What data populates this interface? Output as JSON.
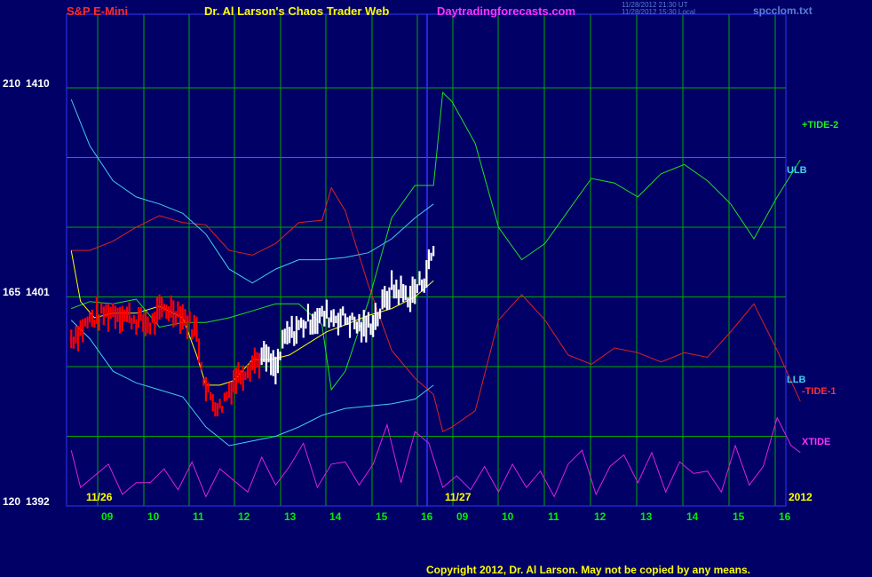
{
  "header": {
    "instrument": "S&P E-Mini",
    "site_title": "Dr. Al Larson's Chaos Trader Web",
    "site_url": "Daytradingforecasts.com",
    "timestamp_ut": "11/28/2012 21:30 UT",
    "timestamp_local": "11/28/2012 15:30 Local",
    "filename": "spcclom.txt"
  },
  "footer": {
    "copyright": "Copyright 2012, Dr. Al Larson. May not be copied by any means."
  },
  "colors": {
    "background": "#000066",
    "grid": "#00aa00",
    "divider": "#3333ff",
    "price_up": "#ffffff",
    "price_down": "#ff0000",
    "tide2": "#22dd22",
    "tide1": "#dd2222",
    "xtide": "#dd22dd",
    "ulb": "#44ccee",
    "llb": "#44ccee",
    "ma": "#ffff00"
  },
  "chart_data": {
    "type": "line",
    "title": "S&P E-Mini",
    "y_left_labels": [
      {
        "osc": "210",
        "price": "1410"
      },
      {
        "osc": "165",
        "price": "1401"
      },
      {
        "osc": "120",
        "price": "1392"
      }
    ],
    "ylim": [
      1392,
      1410
    ],
    "date_labels": [
      "11/26",
      "11/27",
      "2012"
    ],
    "x_ticks_day1": [
      "09",
      "10",
      "11",
      "12",
      "13",
      "14",
      "15",
      "16"
    ],
    "x_ticks_day2": [
      "09",
      "10",
      "11",
      "12",
      "13",
      "14",
      "15",
      "16"
    ],
    "grid": true,
    "series_labels": {
      "tide2": "+TIDE-2",
      "ulb": "ULB",
      "llb": "LLB",
      "tide1": "-TIDE-1",
      "xtide": "XTIDE"
    },
    "series": [
      {
        "name": "+TIDE-2",
        "x": [
          8.1,
          8.5,
          9,
          9.5,
          10,
          10.5,
          11,
          11.5,
          12,
          12.5,
          13,
          13.5,
          13.7,
          14,
          14.5,
          15,
          15.5,
          15.9,
          16.1,
          16.3,
          16.8,
          17.3,
          17.8,
          18.3,
          18.8,
          19.3,
          19.8,
          20.3,
          20.8,
          21.3,
          21.8,
          22.3,
          22.8,
          23.3,
          23.8
        ],
        "y": [
          1400.5,
          1400.8,
          1400.7,
          1400.9,
          1399.7,
          1399.9,
          1399.9,
          1400.1,
          1400.4,
          1400.7,
          1400.7,
          1399.8,
          1397,
          1397.8,
          1400.8,
          1404.4,
          1405.8,
          1405.8,
          1409.8,
          1409.4,
          1407.6,
          1404,
          1402.6,
          1403.3,
          1404.7,
          1406.1,
          1405.9,
          1405.3,
          1406.3,
          1406.7,
          1406,
          1405,
          1403.5,
          1405.3,
          1406.9
        ]
      },
      {
        "name": "-TIDE-1",
        "x": [
          8.1,
          8.5,
          9,
          9.5,
          10,
          10.5,
          11,
          11.5,
          12,
          12.5,
          13,
          13.5,
          13.7,
          14,
          14.5,
          15,
          15.5,
          15.9,
          16.1,
          16.3,
          16.8,
          17.3,
          17.8,
          18.3,
          18.8,
          19.3,
          19.8,
          20.3,
          20.8,
          21.3,
          21.8,
          22.3,
          22.8,
          23.3,
          23.8
        ],
        "y": [
          1403,
          1403,
          1403.4,
          1404,
          1404.5,
          1404.2,
          1404.1,
          1403,
          1402.8,
          1403.3,
          1404.2,
          1404.3,
          1405.7,
          1404.7,
          1401.5,
          1398.7,
          1397.5,
          1396.8,
          1395.2,
          1395.4,
          1396.1,
          1400,
          1401.1,
          1400,
          1398.5,
          1398.1,
          1398.8,
          1398.6,
          1398.2,
          1398.6,
          1398.4,
          1399.5,
          1400.7,
          1398.7,
          1396.5
        ]
      },
      {
        "name": "ULB",
        "x": [
          8.1,
          8.5,
          9,
          9.5,
          10,
          10.5,
          11,
          11.5,
          12,
          12.5,
          13,
          13.5,
          14,
          14.5,
          15,
          15.5,
          15.9
        ],
        "y": [
          1409.5,
          1407.5,
          1406,
          1405.3,
          1405,
          1404.6,
          1403.7,
          1402.2,
          1401.6,
          1402.2,
          1402.6,
          1402.6,
          1402.7,
          1402.9,
          1403.5,
          1404.4,
          1405
        ]
      },
      {
        "name": "LLB",
        "x": [
          8.1,
          8.5,
          9,
          9.5,
          10,
          10.5,
          11,
          11.5,
          12,
          12.5,
          13,
          13.5,
          14,
          14.5,
          15,
          15.5,
          15.9
        ],
        "y": [
          1400,
          1399.2,
          1397.8,
          1397.3,
          1397,
          1396.7,
          1395.4,
          1394.6,
          1394.8,
          1395,
          1395.4,
          1395.9,
          1396.2,
          1396.3,
          1396.4,
          1396.6,
          1397.2
        ]
      },
      {
        "name": "MA",
        "x": [
          8.1,
          8.3,
          8.6,
          9,
          9.5,
          10,
          10.5,
          10.8,
          11,
          11.3,
          11.6,
          12,
          12.4,
          12.8,
          13.2,
          13.6,
          14,
          14.5,
          15,
          15.5,
          15.9
        ],
        "y": [
          1403,
          1400.8,
          1400.1,
          1400.3,
          1400.3,
          1400.6,
          1400.1,
          1398.5,
          1397.2,
          1397.2,
          1397.4,
          1398.3,
          1398.3,
          1398.5,
          1399,
          1399.5,
          1399.8,
          1400.2,
          1400.5,
          1401,
          1401.7
        ]
      },
      {
        "name": "XTIDE",
        "x": [
          8.1,
          8.3,
          8.6,
          8.9,
          9.2,
          9.5,
          9.8,
          10.1,
          10.4,
          10.7,
          11,
          11.3,
          11.6,
          11.9,
          12.2,
          12.5,
          12.8,
          13.1,
          13.4,
          13.7,
          14,
          14.3,
          14.6,
          14.9,
          15.2,
          15.5,
          15.8,
          16.1,
          16.4,
          16.7,
          17,
          17.3,
          17.6,
          17.9,
          18.2,
          18.5,
          18.8,
          19.1,
          19.4,
          19.7,
          20,
          20.3,
          20.6,
          20.9,
          21.2,
          21.5,
          21.8,
          22.1,
          22.4,
          22.7,
          23,
          23.3,
          23.6,
          23.8
        ],
        "y": [
          1394.4,
          1392.8,
          1393.3,
          1393.8,
          1392.5,
          1393,
          1393,
          1393.6,
          1392.7,
          1393.9,
          1392.4,
          1393.6,
          1393.1,
          1392.6,
          1394.1,
          1392.9,
          1393.7,
          1394.7,
          1392.8,
          1393.8,
          1393.9,
          1392.9,
          1393.8,
          1395.5,
          1393,
          1395.2,
          1394.7,
          1392.8,
          1393.3,
          1392.7,
          1393.7,
          1392.6,
          1393.8,
          1392.8,
          1393.5,
          1392.4,
          1393.8,
          1394.4,
          1392.5,
          1393.7,
          1394.2,
          1393,
          1394.3,
          1392.6,
          1393.9,
          1393.4,
          1393.5,
          1392.6,
          1394.6,
          1392.9,
          1393.7,
          1395.8,
          1394.6,
          1394.3
        ]
      }
    ]
  }
}
